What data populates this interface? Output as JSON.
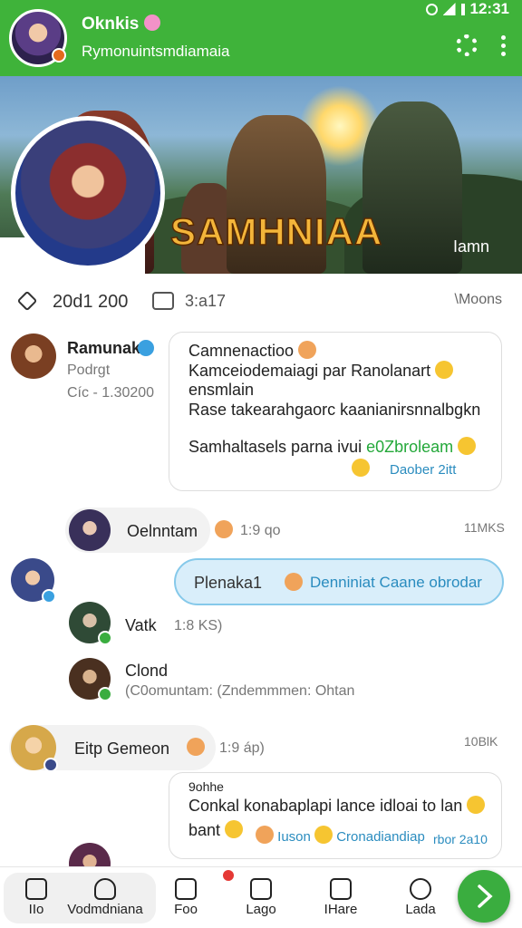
{
  "status_bar": {
    "time": "12:31"
  },
  "header": {
    "title": "Oknkis",
    "subtitle": "Rymonuintsmdiamaia"
  },
  "banner": {
    "logo": "SAMHNIAA",
    "tag": "Iamn"
  },
  "stats": {
    "count": "20d1 200",
    "time": "3:a17",
    "right": "\\Moons"
  },
  "posts": [
    {
      "name": "Ramunakl",
      "role": "Podrgt",
      "meta": "Cíc - 1.30200",
      "lines": [
        "Camnenactioo",
        "Kamceiodemaiagi par Ranolanart",
        "ensmlain",
        "Rase takearahgaorc kaanianirsnnalbgkn",
        "Samhaltasels parna ivui",
        "e0Zbroleam",
        "Daober 2itt"
      ]
    },
    {
      "name": "Oelnntam",
      "meta": "1:9 qo",
      "right": "11MKS"
    },
    {
      "pill_left": "Plenaka1",
      "pill_right": "Denniniat  Caane obrodar"
    },
    {
      "name": "Vatk",
      "meta": "1:8 KS)"
    },
    {
      "name": "Clond",
      "meta": "(C0omuntam: (Zndemmmen: Ohtan"
    },
    {
      "name": "Eitp Gemeon",
      "meta": "1:9 áp)",
      "right": "10BlK"
    },
    {
      "lines": [
        "9ohhe",
        "Conkal konabaplapi lance idloai to lan",
        "bant",
        "Iuson",
        "Cronadiandiap",
        "rbor 2a10"
      ]
    }
  ],
  "nav": {
    "tabs": [
      "IIo",
      "Vodmdniana",
      "Foo",
      "Lago",
      "IHare",
      "Lada"
    ]
  }
}
